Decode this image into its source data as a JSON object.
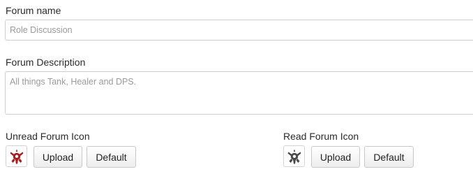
{
  "forum_name": {
    "label": "Forum name",
    "placeholder": "Role Discussion",
    "value": ""
  },
  "forum_description": {
    "label": "Forum Description",
    "placeholder": "All things Tank, Healer and DPS.",
    "value": ""
  },
  "unread_icon": {
    "label": "Unread Forum Icon",
    "icon": "horde-emblem-icon",
    "icon_color": "#a81e1e",
    "upload_label": "Upload",
    "default_label": "Default"
  },
  "read_icon": {
    "label": "Read Forum Icon",
    "icon": "horde-emblem-icon",
    "icon_color": "#4a4a4a",
    "upload_label": "Upload",
    "default_label": "Default"
  }
}
